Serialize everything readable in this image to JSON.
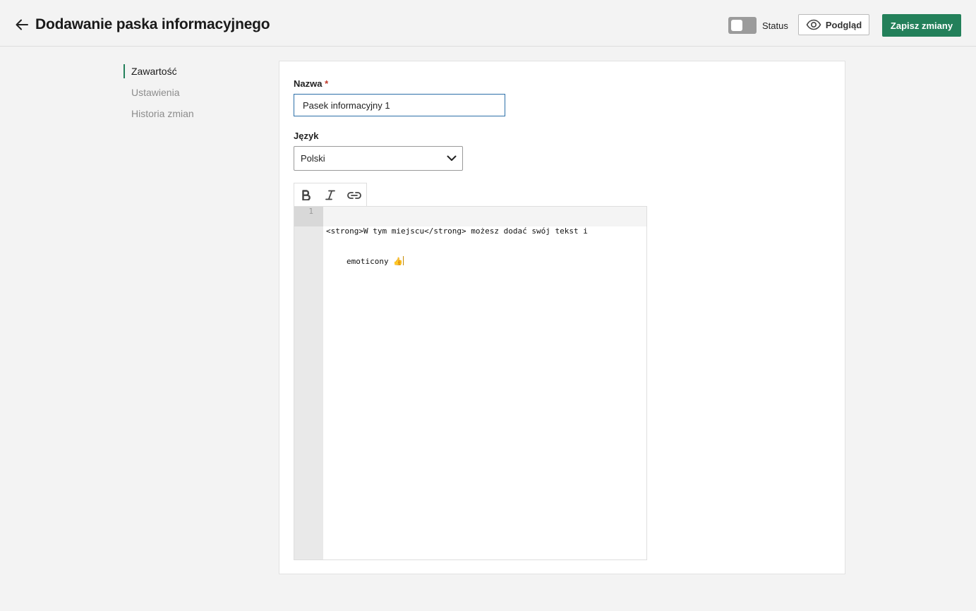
{
  "header": {
    "title": "Dodawanie paska informacyjnego",
    "status_label": "Status",
    "preview_label": "Podgląd",
    "save_label": "Zapisz zmiany",
    "accent_color": "#23805a",
    "status_enabled": false
  },
  "sidebar": {
    "items": [
      {
        "label": "Zawartość",
        "active": true
      },
      {
        "label": "Ustawienia",
        "active": false
      },
      {
        "label": "Historia zmian",
        "active": false
      }
    ]
  },
  "form": {
    "name_label": "Nazwa",
    "required_mark": "*",
    "name_value": "Pasek informacyjny 1",
    "language_label": "Język",
    "language_value": "Polski"
  },
  "editor": {
    "toolbar": [
      "bold-icon",
      "italic-icon",
      "link-icon"
    ],
    "line_number": "1",
    "code_line1": "<strong>W tym miejscu</strong> możesz dodać swój tekst i",
    "code_line2": "emoticony 👍"
  }
}
